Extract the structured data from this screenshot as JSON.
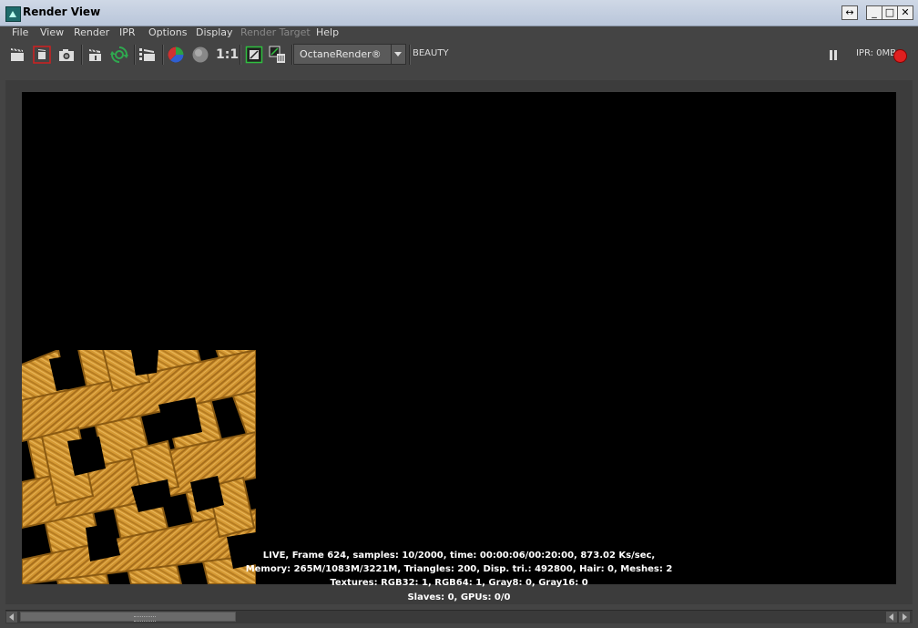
{
  "window": {
    "title": "Render View",
    "controls": {
      "resize": "↔",
      "minimize": "_",
      "maximize": "□",
      "close": "✕"
    }
  },
  "menu": {
    "items": [
      "File",
      "View",
      "Render",
      "IPR",
      "Options",
      "Display",
      "Render Target",
      "Help"
    ],
    "disabled": [
      "Render Target"
    ]
  },
  "toolbar": {
    "ratio_label": "1:1",
    "renderer": "OctaneRender®",
    "pass": "BEAUTY",
    "ipr_status": "IPR: 0MB",
    "icons": [
      "clapperboard-icon",
      "render-region-icon",
      "snapshot-camera-icon",
      "ipr-clapper-icon",
      "refresh-icon",
      "render-settings-icon",
      "rgb-channel-icon",
      "alpha-channel-icon",
      "display-icon",
      "keep-image-icon",
      "pause-icon",
      "record-icon"
    ],
    "colors": {
      "refresh": "#2fa84f",
      "record": "#e02020",
      "region_border": "#d02020",
      "display_border": "#2fbf3f"
    }
  },
  "render": {
    "subject": "woven yarn texture",
    "colors": {
      "yarn": "#d69a34",
      "yarn_shadow": "#8a5a12",
      "background": "#000000"
    }
  },
  "stats": {
    "line1": "LIVE, Frame 624, samples: 10/2000, time: 00:00:06/00:20:00, 873.02 Ks/sec,",
    "line2": "Memory: 265M/1083M/3221M, Triangles: 200, Disp. tri.: 492800, Hair: 0, Meshes: 2",
    "line3": "Textures: RGB32: 1, RGB64: 1, Gray8: 0, Gray16: 0",
    "line4": "Slaves: 0, GPUs: 0/0"
  }
}
